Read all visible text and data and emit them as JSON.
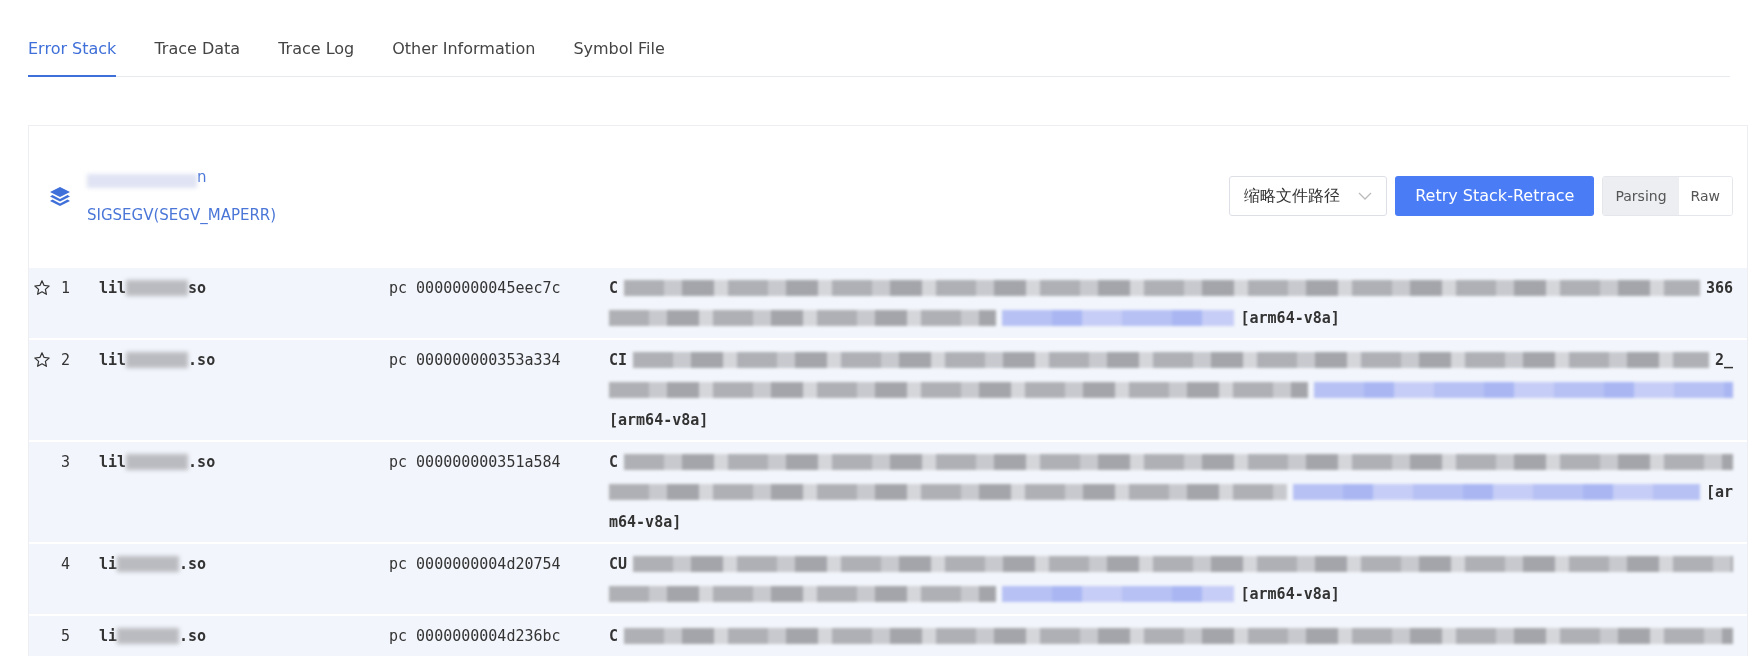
{
  "tabs": [
    {
      "label": "Error Stack",
      "selected": true
    },
    {
      "label": "Trace Data",
      "selected": false
    },
    {
      "label": "Trace Log",
      "selected": false
    },
    {
      "label": "Other Information",
      "selected": false
    },
    {
      "label": "Symbol File",
      "selected": false
    }
  ],
  "crash": {
    "title_tail": "n",
    "signal": "SIGSEGV(SEGV_MAPERR)"
  },
  "path_select": {
    "value": "缩略文件路径"
  },
  "retry_button": "Retry Stack-Retrace",
  "view_modes": [
    {
      "label": "Parsing",
      "selected": true
    },
    {
      "label": "Raw",
      "selected": false
    }
  ],
  "frames": [
    {
      "flagged": true,
      "index": "1",
      "lib_head": "lil",
      "lib_tail": "so",
      "pc": "pc 00000000045eec7c",
      "lines": [
        [
          {
            "kind": "text",
            "text": "C"
          },
          {
            "kind": "blur"
          },
          {
            "kind": "text",
            "text": "366"
          }
        ],
        [
          {
            "kind": "blur"
          },
          {
            "kind": "link_blur"
          },
          {
            "kind": "text",
            "text": "[arm64-v8a]"
          },
          {
            "kind": "space"
          }
        ]
      ]
    },
    {
      "flagged": true,
      "index": "2",
      "lib_head": "lil",
      "lib_tail": ".so",
      "pc": "pc 000000000353a334",
      "lines": [
        [
          {
            "kind": "text",
            "text": "CI"
          },
          {
            "kind": "blur"
          },
          {
            "kind": "text",
            "text": "2_"
          }
        ],
        [
          {
            "kind": "blur"
          },
          {
            "kind": "link_blur"
          }
        ],
        [
          {
            "kind": "text",
            "text": "[arm64-v8a]"
          },
          {
            "kind": "space"
          }
        ]
      ]
    },
    {
      "flagged": false,
      "index": "3",
      "lib_head": "lil",
      "lib_tail": ".so",
      "pc": "pc 000000000351a584",
      "lines": [
        [
          {
            "kind": "text",
            "text": "C"
          },
          {
            "kind": "blur"
          }
        ],
        [
          {
            "kind": "blur"
          },
          {
            "kind": "link_blur"
          },
          {
            "kind": "text",
            "text": "[ar"
          }
        ],
        [
          {
            "kind": "text",
            "text": "m64-v8a]"
          },
          {
            "kind": "space"
          }
        ]
      ]
    },
    {
      "flagged": false,
      "index": "4",
      "lib_head": "li",
      "lib_tail": ".so",
      "pc": "pc 0000000004d20754",
      "lines": [
        [
          {
            "kind": "text",
            "text": "CU"
          },
          {
            "kind": "blur"
          }
        ],
        [
          {
            "kind": "blur"
          },
          {
            "kind": "link_blur"
          },
          {
            "kind": "text",
            "text": "[arm64-v8a]"
          },
          {
            "kind": "space"
          }
        ]
      ]
    },
    {
      "flagged": false,
      "index": "5",
      "lib_head": "li",
      "lib_tail": ".so",
      "pc": "pc 0000000004d236bc",
      "lines": [
        [
          {
            "kind": "text",
            "text": "C"
          },
          {
            "kind": "blur"
          }
        ]
      ]
    }
  ]
}
